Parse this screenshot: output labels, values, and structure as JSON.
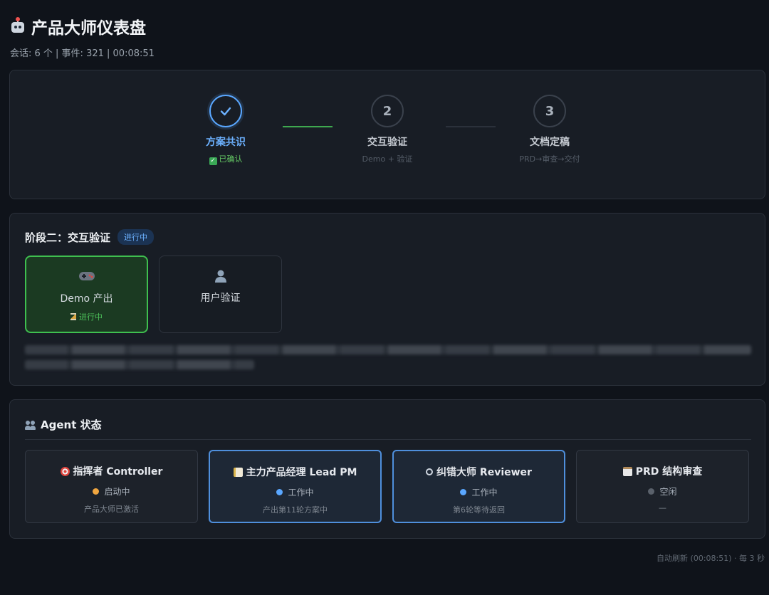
{
  "header": {
    "title": "产品大师仪表盘",
    "subtitle": "会话: 6 个 | 事件: 321 | 00:08:51"
  },
  "stepper": {
    "steps": [
      {
        "number": "✓",
        "title": "方案共识",
        "sub": "已确认",
        "state": "done"
      },
      {
        "number": "2",
        "title": "交互验证",
        "sub": "Demo + 验证",
        "state": "current"
      },
      {
        "number": "3",
        "title": "文档定稿",
        "sub": "PRD→审查→交付",
        "state": "pending"
      }
    ]
  },
  "phase": {
    "title": "阶段二：交互验证",
    "badge": "进行中",
    "tasks": [
      {
        "icon": "gamepad-icon",
        "name": "Demo 产出",
        "status": "进行中",
        "active": true
      },
      {
        "icon": "user-icon",
        "name": "用户验证",
        "status": "",
        "active": false
      }
    ]
  },
  "agents": {
    "title": "Agent 状态",
    "items": [
      {
        "icon": "target-icon",
        "name": "指挥者 Controller",
        "state": "启动中",
        "dot_color": "#f0a640",
        "note": "产品大师已激活"
      },
      {
        "icon": "memo-icon",
        "name": "主力产品经理 Lead PM",
        "state": "工作中",
        "dot_color": "#5aa7ff",
        "note": "产出第11轮方案中"
      },
      {
        "icon": "search-icon",
        "name": "纠错大师 Reviewer",
        "state": "工作中",
        "dot_color": "#5aa7ff",
        "note": "第6轮等待返回"
      },
      {
        "icon": "clipboard-icon",
        "name": "PRD 结构审查",
        "state": "空闲",
        "dot_color": "#5a616b",
        "note": "—"
      }
    ]
  },
  "footer": "自动刷新 (00:08:51) · 每 3 秒"
}
